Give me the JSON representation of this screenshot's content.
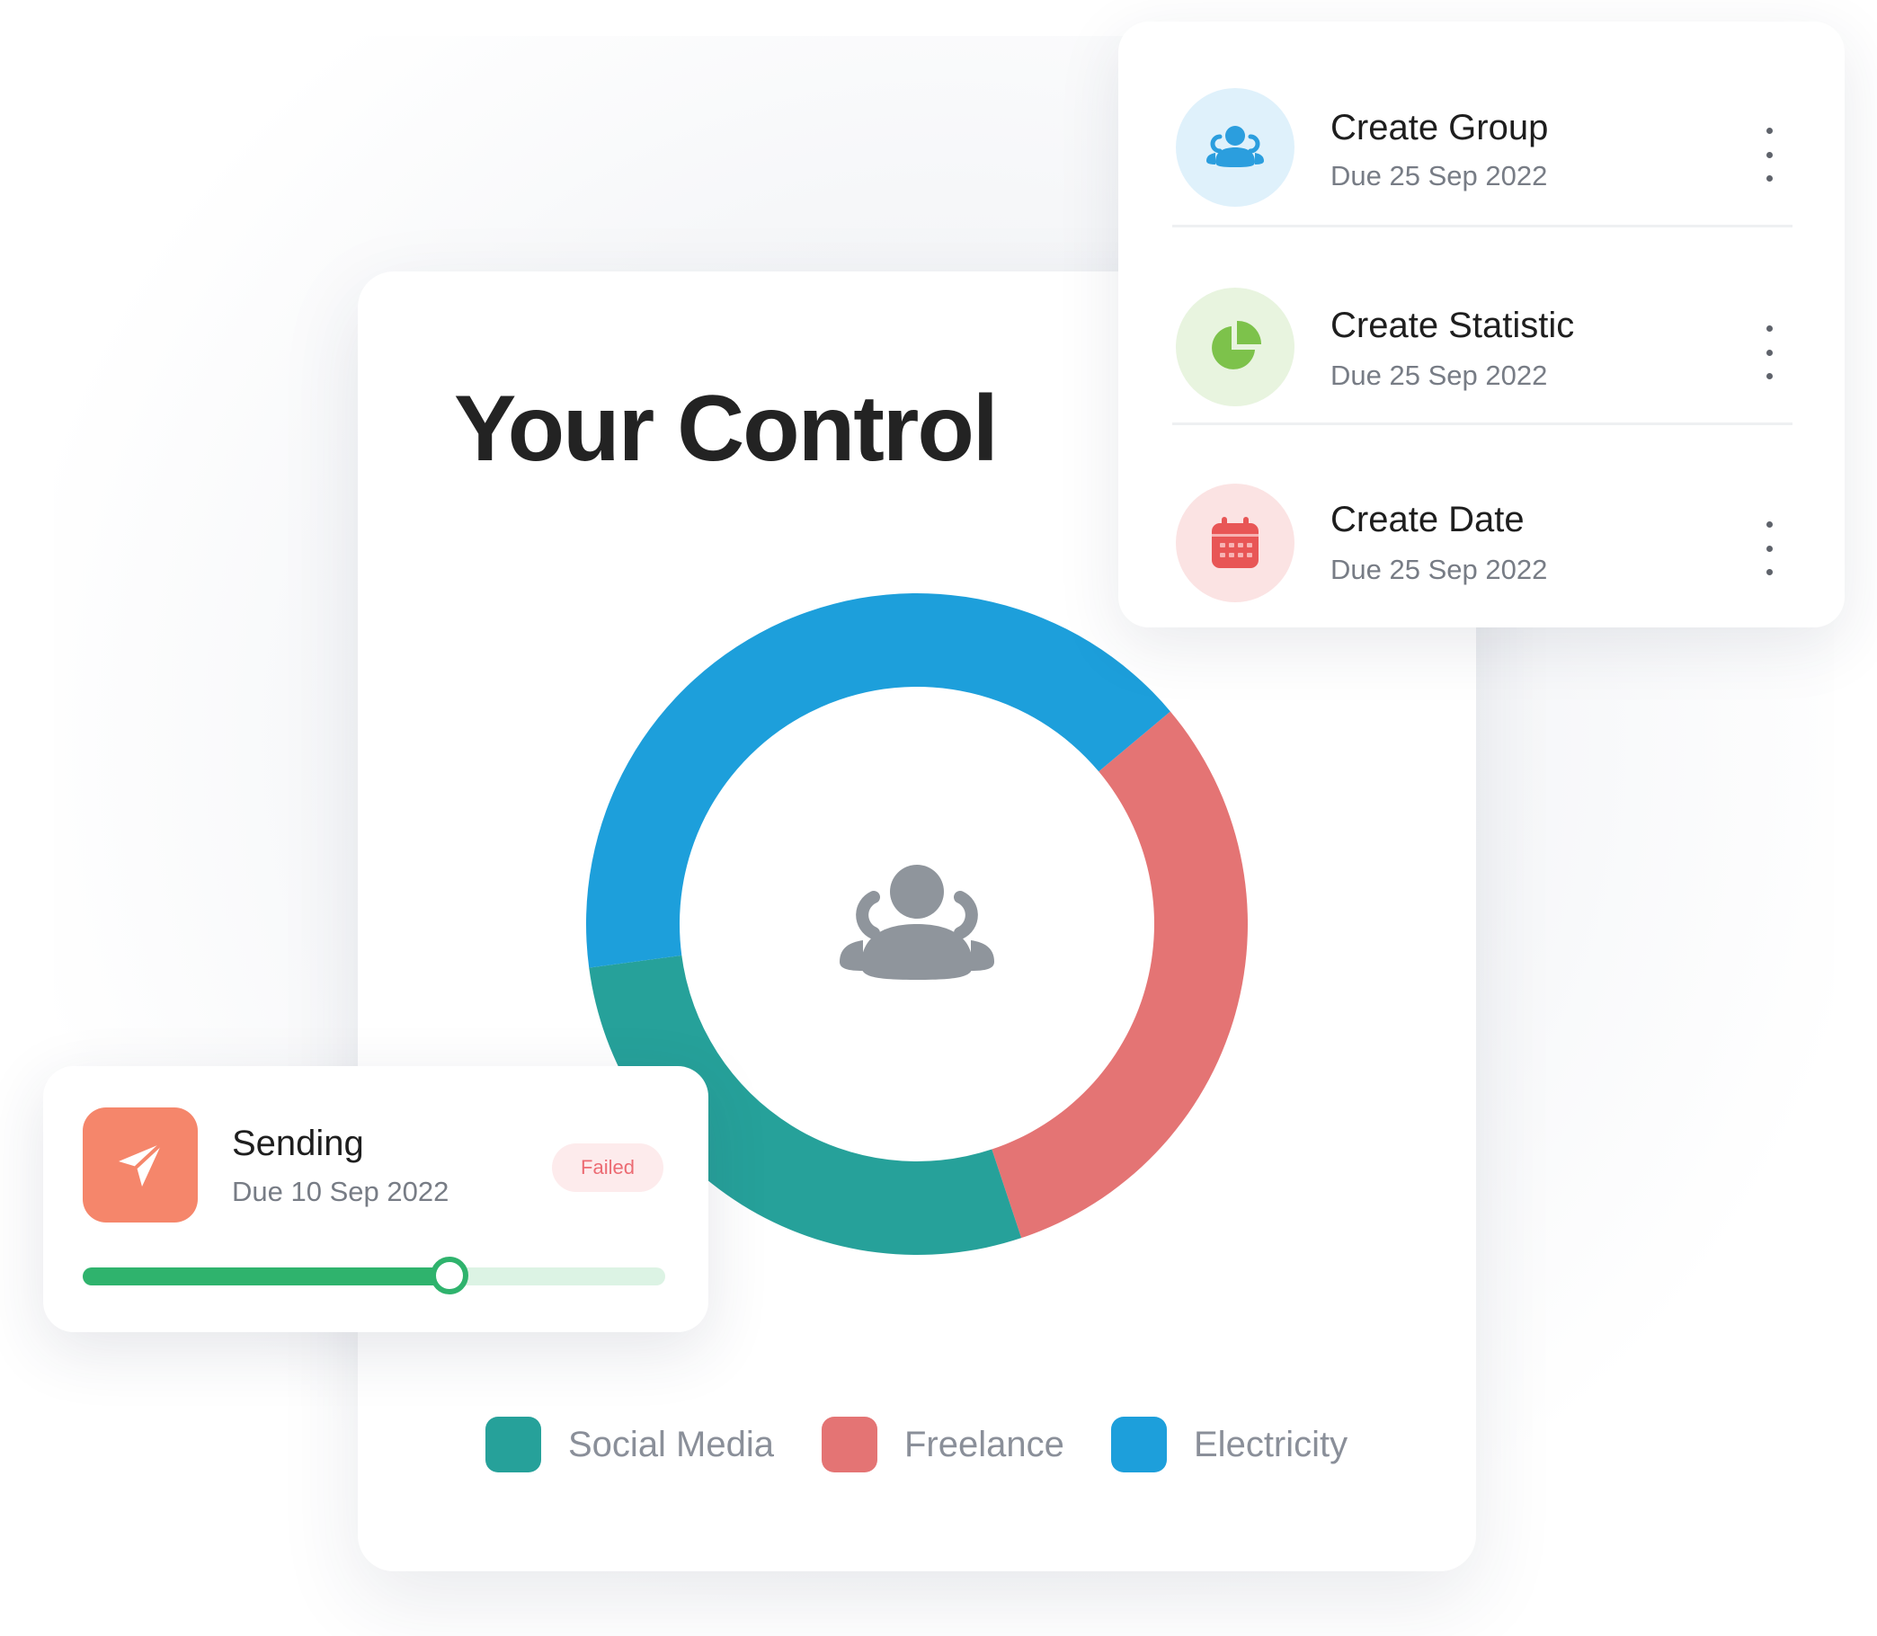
{
  "main": {
    "title": "Your Control"
  },
  "chart_data": {
    "type": "pie",
    "categories": [
      "Social Media",
      "Freelance",
      "Electricity"
    ],
    "values": [
      28,
      31,
      41
    ],
    "colors": [
      "#26a19a",
      "#e47474",
      "#1d9fdb"
    ],
    "legend_position": "bottom"
  },
  "tasks": [
    {
      "title": "Create Group",
      "due": "Due 25 Sep 2022",
      "icon": "group-icon",
      "icon_color": "#2b9ede",
      "icon_bg": "#dff1fb"
    },
    {
      "title": "Create Statistic",
      "due": "Due 25 Sep 2022",
      "icon": "pie-chart-icon",
      "icon_color": "#7dc24b",
      "icon_bg": "#e8f4df"
    },
    {
      "title": "Create Date",
      "due": "Due 25 Sep 2022",
      "icon": "calendar-icon",
      "icon_color": "#e85656",
      "icon_bg": "#fbe3e3"
    }
  ],
  "sending": {
    "title": "Sending",
    "due": "Due 10 Sep 2022",
    "status": "Failed",
    "progress": 0.63,
    "icon": "send-icon",
    "accent": "#f5866b",
    "progress_color": "#2fb36d"
  }
}
